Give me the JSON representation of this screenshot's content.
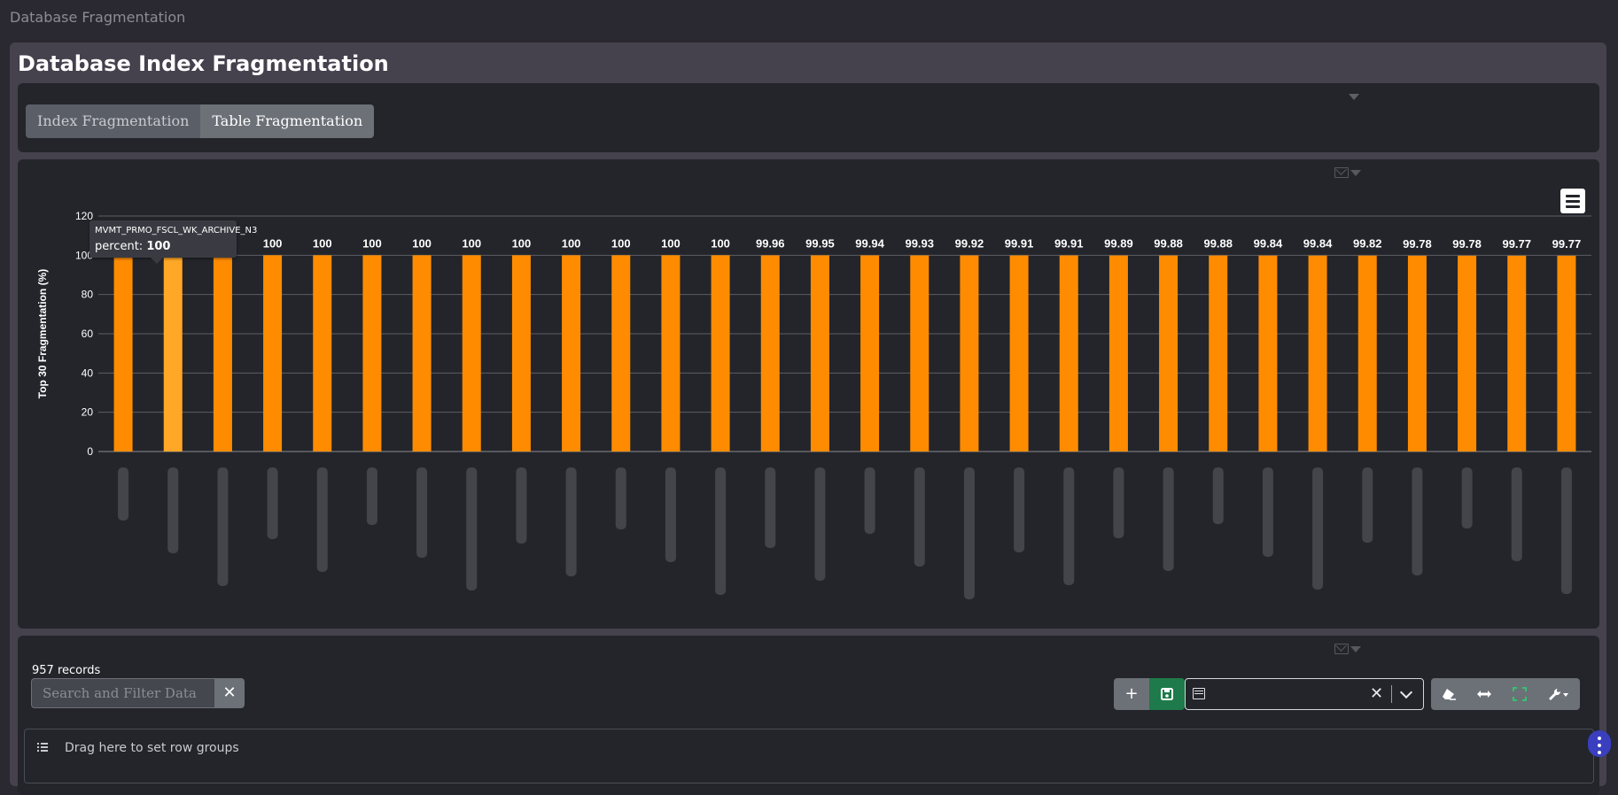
{
  "breadcrumb": "Database Fragmentation",
  "page_title": "Database Index Fragmentation",
  "tabs": [
    {
      "label": "Index Fragmentation",
      "active": false
    },
    {
      "label": "Table Fragmentation",
      "active": true
    }
  ],
  "tooltip": {
    "name": "MVMT_PRMO_FSCL_WK_ARCHIVE_N3",
    "label": "percent:",
    "value": "100"
  },
  "chart_data": {
    "type": "bar",
    "ylabel": "Top 30 Fragmentation (%)",
    "xlabel": "",
    "ylim": [
      0,
      120
    ],
    "yticks": [
      0,
      20,
      40,
      60,
      80,
      100,
      120
    ],
    "grid": true,
    "bar_color": "#ff8c00",
    "highlight_color": "#ffa726",
    "highlight_index": 1,
    "values": [
      100,
      100,
      100,
      100,
      100,
      100,
      100,
      100,
      100,
      100,
      100,
      100,
      100,
      99.96,
      99.95,
      99.94,
      99.93,
      99.92,
      99.91,
      99.91,
      99.89,
      99.88,
      99.88,
      99.84,
      99.84,
      99.82,
      99.78,
      99.78,
      99.77,
      99.77
    ],
    "data_labels": [
      "100",
      "",
      "100",
      "100",
      "100",
      "100",
      "100",
      "100",
      "100",
      "100",
      "100",
      "100",
      "100",
      "99.96",
      "99.95",
      "99.94",
      "99.93",
      "99.92",
      "99.91",
      "99.91",
      "99.89",
      "99.88",
      "99.88",
      "99.84",
      "99.84",
      "99.82",
      "99.78",
      "99.78",
      "99.77",
      "99.77"
    ]
  },
  "grid_section": {
    "records": "957 records",
    "search_placeholder": "Search and Filter Data",
    "clear_symbol": "✕",
    "add_symbol": "+",
    "layout_clear_symbol": "✕",
    "group_panel_text": "Drag here to set row groups"
  },
  "colors": {
    "background": "#2a2830",
    "panel": "#45414d",
    "card": "#23252a",
    "accent": "#ff8c00"
  }
}
